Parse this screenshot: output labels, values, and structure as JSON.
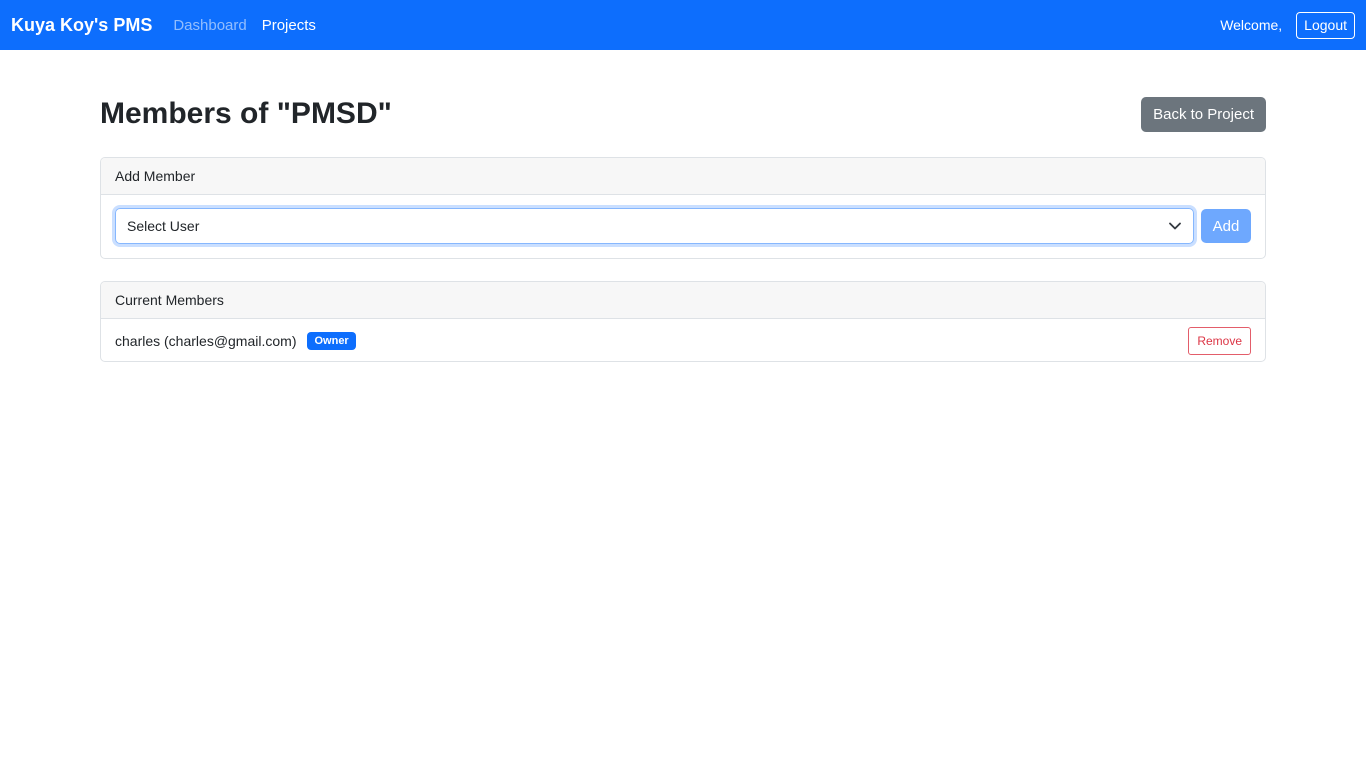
{
  "navbar": {
    "brand": "Kuya Koy's PMS",
    "links": [
      {
        "label": "Dashboard",
        "active": false
      },
      {
        "label": "Projects",
        "active": true
      }
    ],
    "welcome": "Welcome,",
    "logout_label": "Logout"
  },
  "page": {
    "title": "Members of \"PMSD\"",
    "back_label": "Back to Project"
  },
  "add_member": {
    "header": "Add Member",
    "select_value": "Select User",
    "add_label": "Add"
  },
  "current_members": {
    "header": "Current Members",
    "members": [
      {
        "name": "charles (charles@gmail.com)",
        "badge": "Owner",
        "remove_label": "Remove"
      }
    ]
  },
  "colors": {
    "primary": "#0d6efd",
    "secondary": "#6c757d",
    "danger": "#dc3545"
  }
}
